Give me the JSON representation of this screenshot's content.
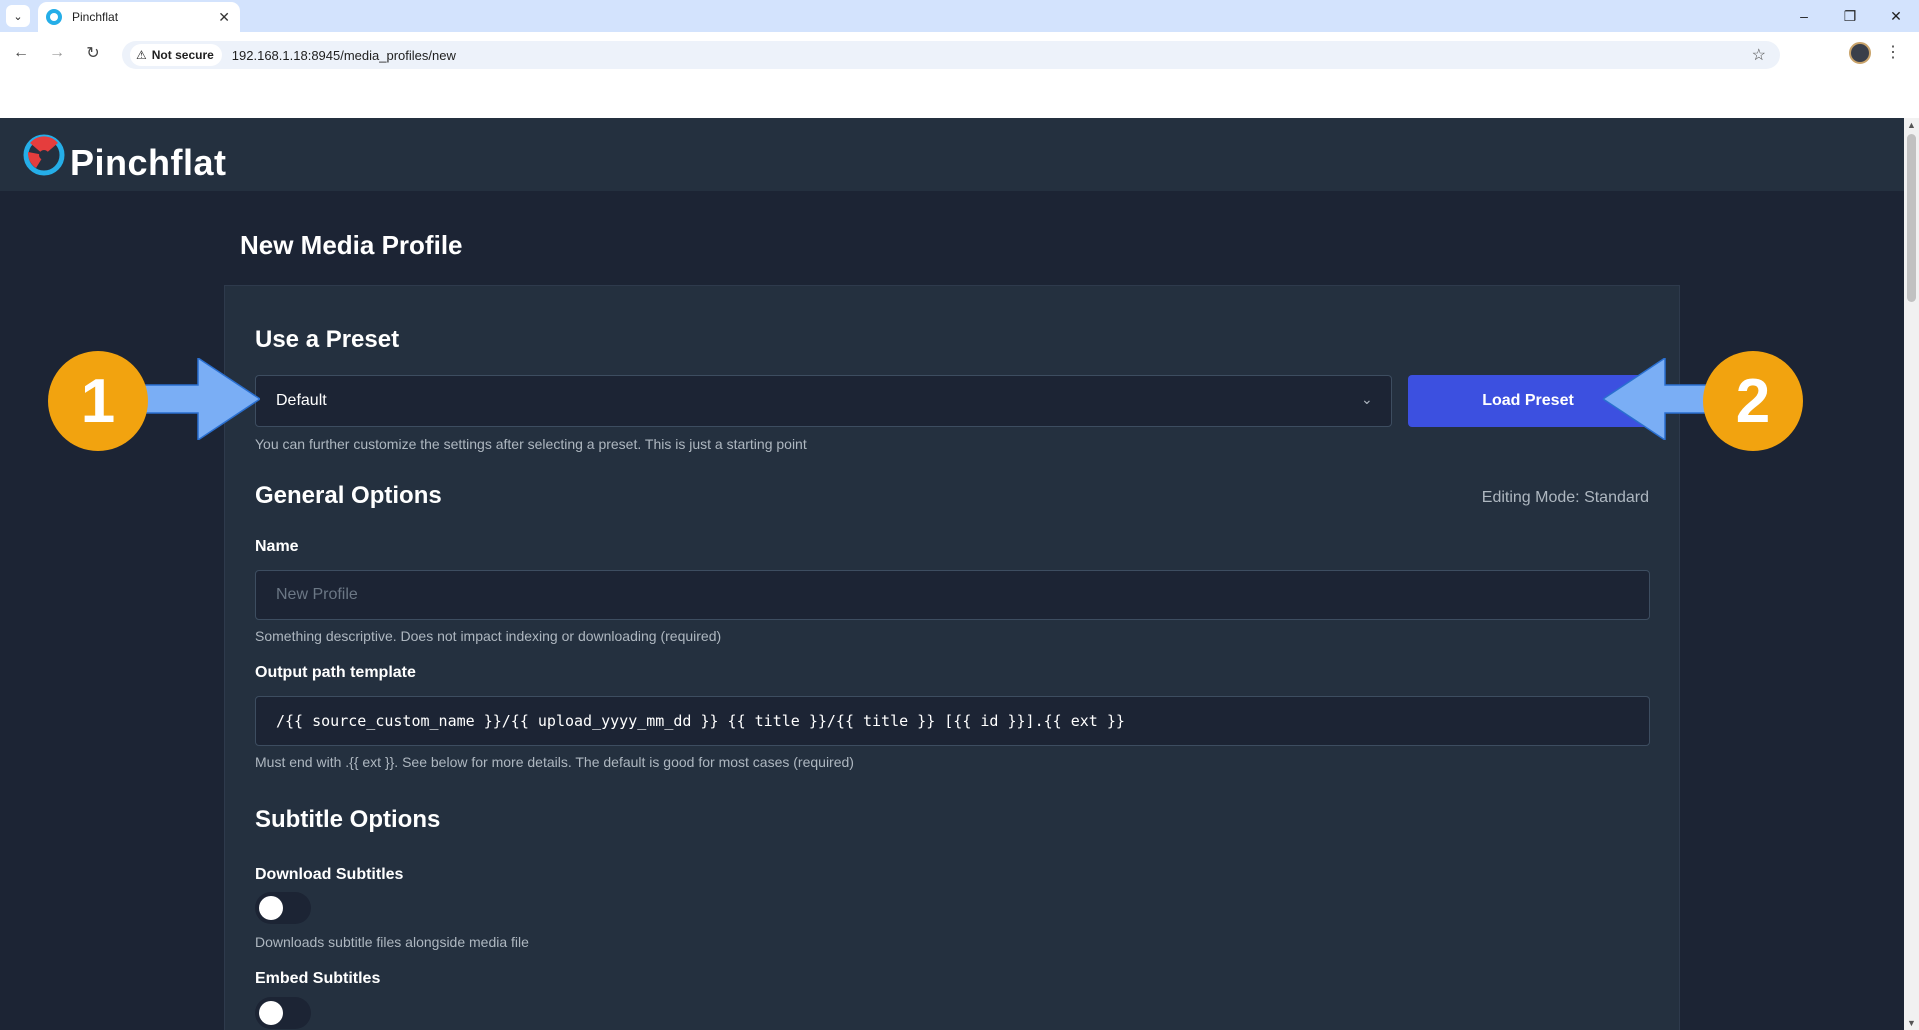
{
  "browser": {
    "tab_title": "Pinchflat",
    "security_label": "Not secure",
    "url": "192.168.1.18:8945/media_profiles/new"
  },
  "app": {
    "name": "Pinchflat"
  },
  "page": {
    "title": "New Media Profile"
  },
  "preset": {
    "section_title": "Use a Preset",
    "selected": "Default",
    "load_button": "Load Preset",
    "help": "You can further customize the settings after selecting a preset. This is just a starting point"
  },
  "general": {
    "section_title": "General Options",
    "editing_mode": "Editing Mode: Standard",
    "name_label": "Name",
    "name_placeholder": "New Profile",
    "name_help": "Something descriptive. Does not impact indexing or downloading (required)",
    "output_label": "Output path template",
    "output_value": "/{{ source_custom_name }}/{{ upload_yyyy_mm_dd }} {{ title }}/{{ title }} [{{ id }}].{{ ext }}",
    "output_help": "Must end with .{{ ext }}. See below for more details. The default is good for most cases (required)"
  },
  "subtitles": {
    "section_title": "Subtitle Options",
    "download_label": "Download Subtitles",
    "download_help": "Downloads subtitle files alongside media file",
    "embed_label": "Embed Subtitles"
  },
  "annotations": {
    "badge_1": "1",
    "badge_2": "2"
  },
  "colors": {
    "accent": "#3c50e0",
    "badge": "#f2a30f",
    "arrow": "#7aaef5",
    "background": "#1c2434",
    "card": "#24303f"
  }
}
